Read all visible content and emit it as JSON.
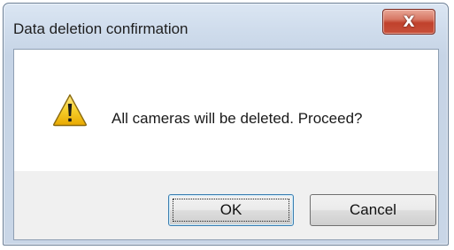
{
  "window": {
    "title": "Data deletion confirmation",
    "close_label": "X"
  },
  "dialog": {
    "icon": "warning-icon",
    "message": "All cameras will be deleted. Proceed?"
  },
  "buttons": {
    "ok_label": "OK",
    "cancel_label": "Cancel"
  },
  "colors": {
    "close_button": "#c8503a",
    "warning_icon": "#f3c31a",
    "focused_border": "#3c7fb1"
  }
}
